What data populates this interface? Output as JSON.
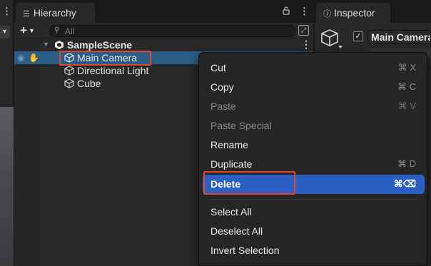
{
  "left_panel": {
    "kebab_icon": "kebab-menu-icon",
    "dropdown_icon": "chevron-down-icon"
  },
  "hierarchy": {
    "tab_label": "Hierarchy",
    "tab_icon": "hierarchy-list-icon",
    "search": {
      "placeholder": "All",
      "value": ""
    },
    "scene": {
      "name": "SampleScene",
      "expanded": true
    },
    "items": [
      {
        "label": "Main Camera",
        "selected": true
      },
      {
        "label": "Directional Light",
        "selected": false
      },
      {
        "label": "Cube",
        "selected": false
      }
    ]
  },
  "inspector": {
    "tab_label": "Inspector",
    "tab_icon": "info-icon",
    "object_name": "Main Camera",
    "active_checked": true
  },
  "context_menu": {
    "items": [
      {
        "label": "Cut",
        "shortcut": "⌘ X",
        "enabled": true
      },
      {
        "label": "Copy",
        "shortcut": "⌘ C",
        "enabled": true
      },
      {
        "label": "Paste",
        "shortcut": "⌘ V",
        "enabled": false
      },
      {
        "label": "Paste Special",
        "shortcut": "",
        "enabled": false
      },
      {
        "label": "Rename",
        "shortcut": "",
        "enabled": true
      },
      {
        "label": "Duplicate",
        "shortcut": "⌘ D",
        "enabled": true
      },
      {
        "label": "Delete",
        "shortcut": "⌘⌫",
        "enabled": true,
        "highlighted": true
      },
      {
        "label": "Select All",
        "shortcut": "",
        "enabled": true
      },
      {
        "label": "Deselect All",
        "shortcut": "",
        "enabled": true
      },
      {
        "label": "Invert Selection",
        "shortcut": "",
        "enabled": true
      }
    ]
  },
  "colors": {
    "selection": "#2c5d87",
    "menu_highlight": "#2b5fc4",
    "annotation_box": "#e2452a"
  }
}
